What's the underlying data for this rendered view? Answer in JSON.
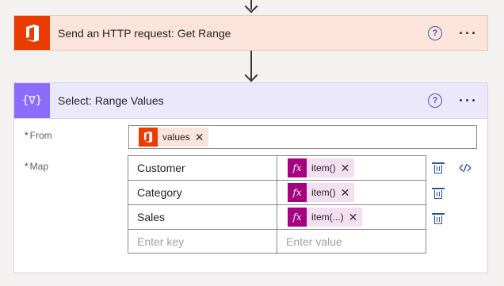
{
  "step1": {
    "title": "Send an HTTP request: Get Range",
    "icon": "office-icon",
    "help_glyph": "?",
    "more_glyph": "···",
    "color": "#eb3c00"
  },
  "step2": {
    "title": "Select: Range Values",
    "icon": "data-operation-icon",
    "icon_glyph": "{∇}",
    "help_glyph": "?",
    "more_glyph": "···",
    "color": "#8c6cff",
    "from": {
      "required_mark": "*",
      "label": "From",
      "token": {
        "text": "values",
        "close": "✕"
      }
    },
    "map": {
      "required_mark": "*",
      "label": "Map",
      "rows": [
        {
          "key": "Customer",
          "value": "item()",
          "close": "✕",
          "fx": "fx"
        },
        {
          "key": "Category",
          "value": "item()",
          "close": "✕",
          "fx": "fx"
        },
        {
          "key": "Sales",
          "value": "item(...)",
          "close": "✕",
          "fx": "fx"
        }
      ],
      "key_placeholder": "Enter key",
      "value_placeholder": "Enter value"
    }
  }
}
